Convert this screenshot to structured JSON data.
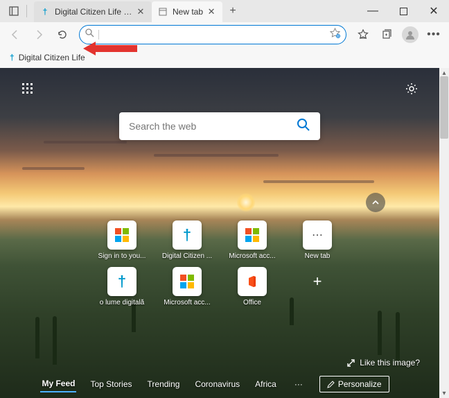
{
  "window": {
    "minimize": "—",
    "maximize": "◻",
    "close": "✕"
  },
  "tabs": [
    {
      "title": "Digital Citizen Life in a digital wo",
      "favicon": "dagger"
    },
    {
      "title": "New tab",
      "favicon": "page"
    }
  ],
  "toolbar": {
    "omnibox_placeholder": ""
  },
  "bookmarks": [
    {
      "title": "Digital Citizen Life",
      "favicon": "dagger"
    }
  ],
  "ntp": {
    "search_placeholder": "Search the web",
    "like_image": "Like this image?",
    "tiles": [
      {
        "label": "Sign in to you...",
        "icon": "ms"
      },
      {
        "label": "Digital Citizen ...",
        "icon": "dagger"
      },
      {
        "label": "Microsoft acc...",
        "icon": "ms"
      },
      {
        "label": "New tab",
        "icon": "dots"
      },
      {
        "label": "o lume digitală",
        "icon": "dagger"
      },
      {
        "label": "Microsoft acc...",
        "icon": "ms"
      },
      {
        "label": "Office",
        "icon": "office"
      }
    ],
    "feed": [
      "My Feed",
      "Top Stories",
      "Trending",
      "Coronavirus",
      "Africa"
    ],
    "feed_more": "···",
    "personalize": "Personalize"
  }
}
